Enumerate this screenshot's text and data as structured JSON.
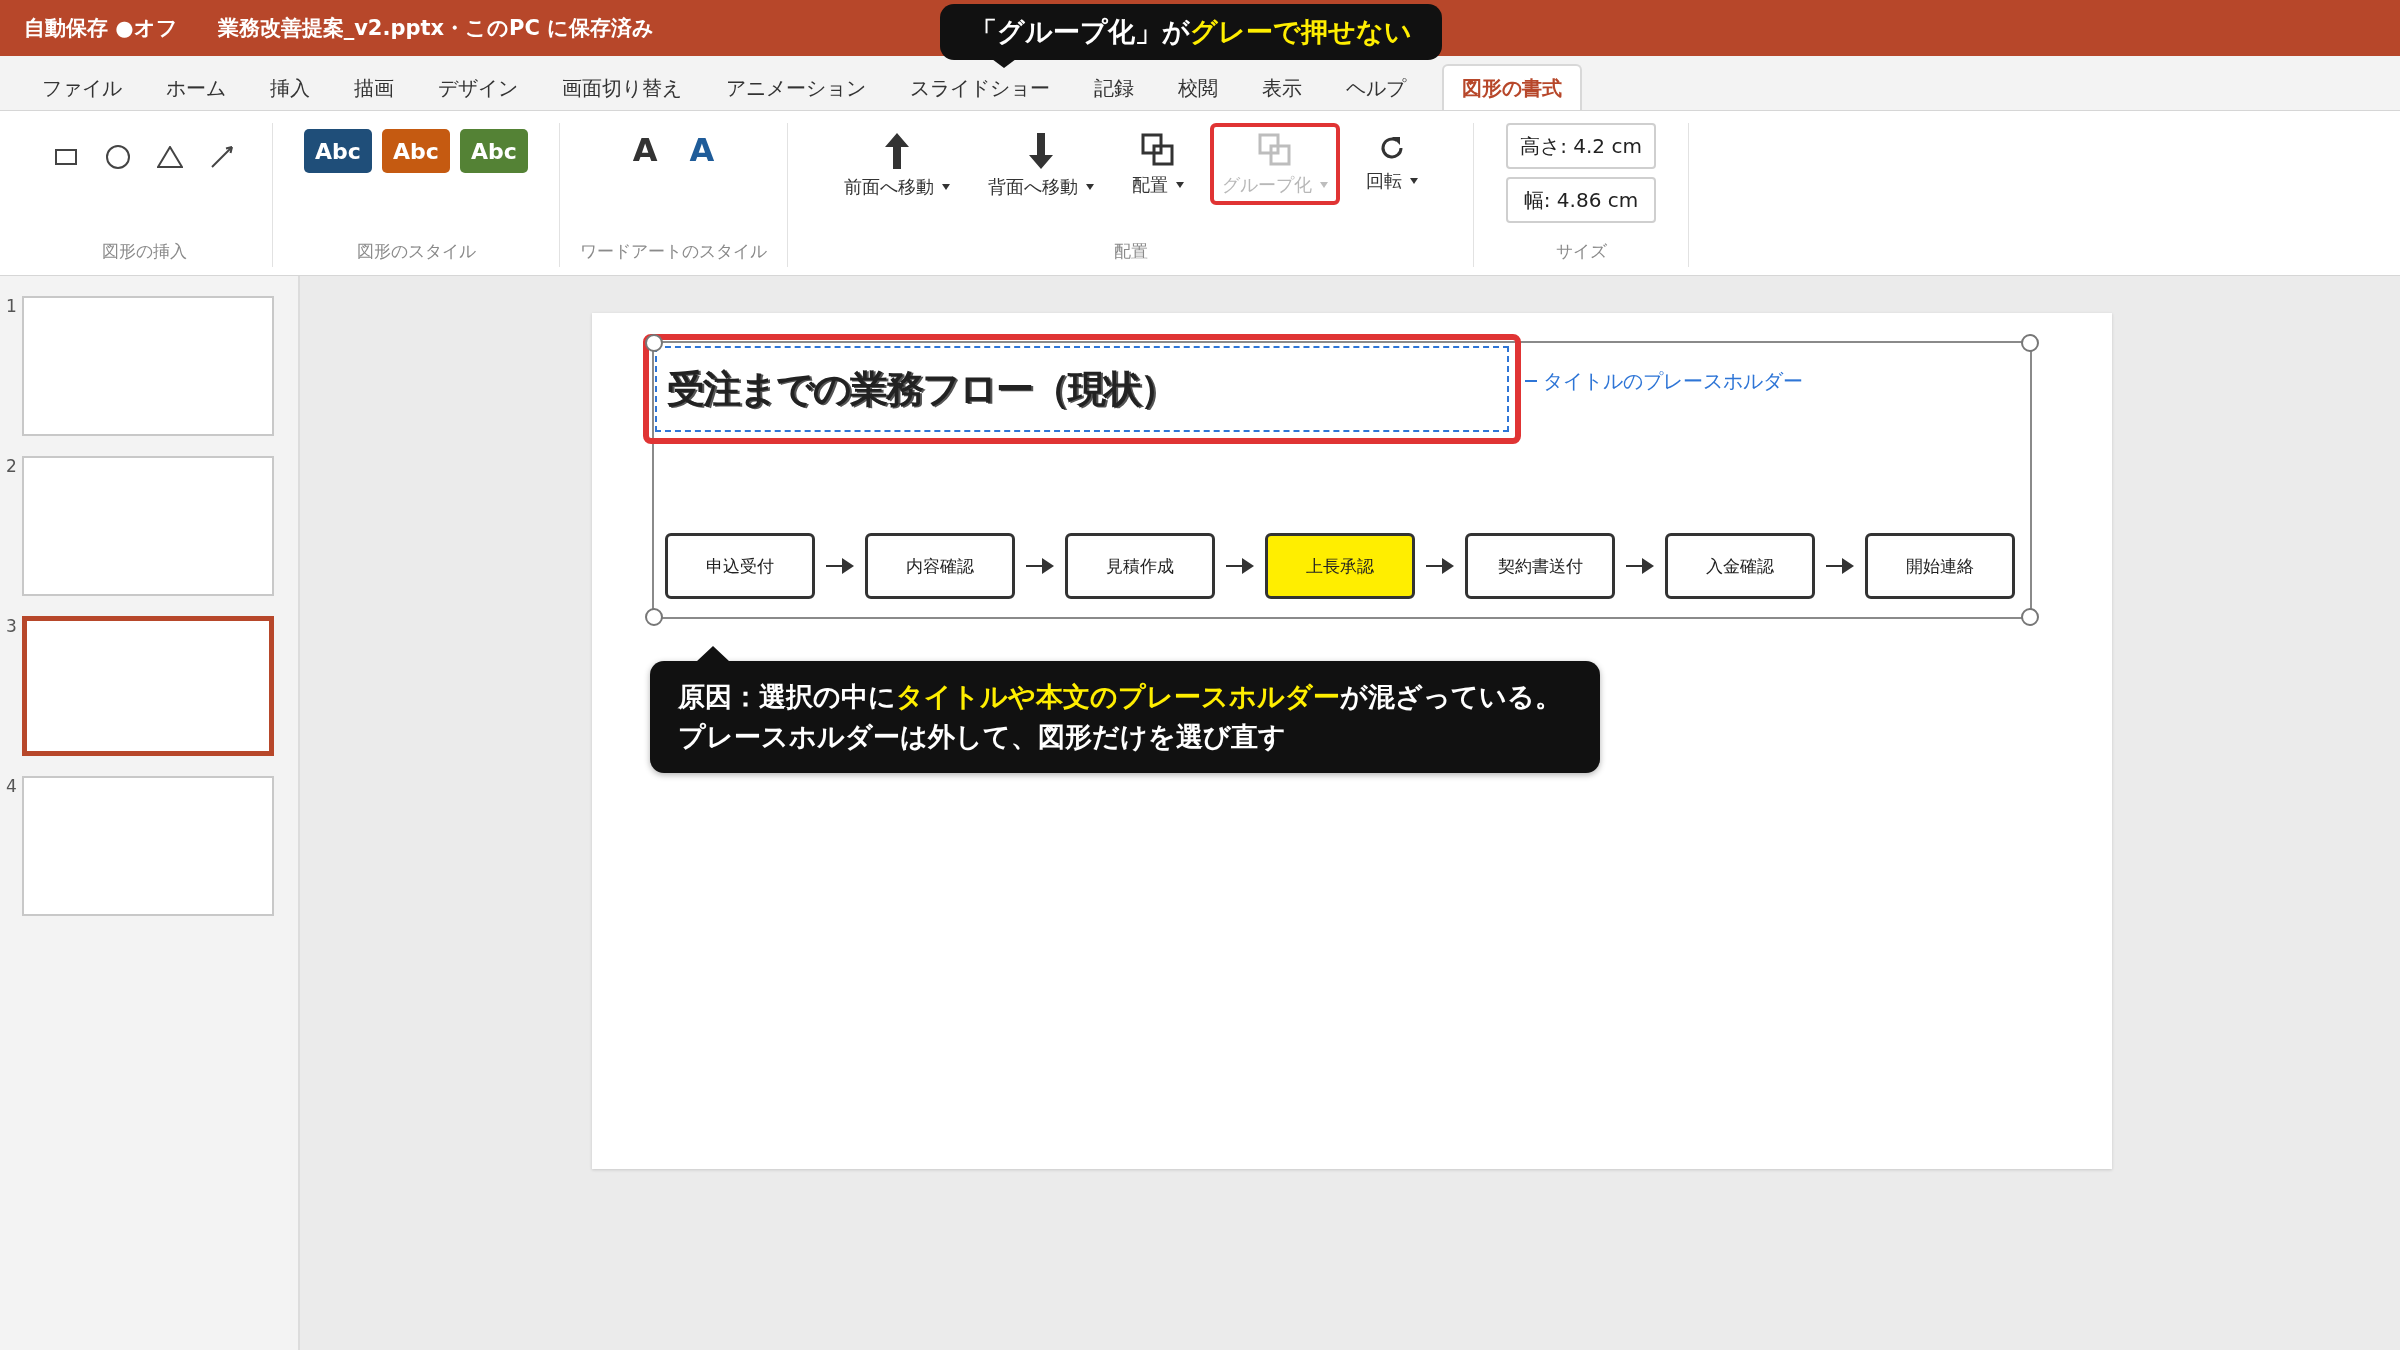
{
  "title_bar": {
    "autosave": "自動保存 ●オフ",
    "document": "業務改善提案_v2.pptx・このPC に保存済み"
  },
  "tabs": [
    {
      "label": "ファイル",
      "selected": false
    },
    {
      "label": "ホーム",
      "selected": false
    },
    {
      "label": "挿入",
      "selected": false
    },
    {
      "label": "描画",
      "selected": false
    },
    {
      "label": "デザイン",
      "selected": false
    },
    {
      "label": "画面切り替え",
      "selected": false
    },
    {
      "label": "アニメーション",
      "selected": false
    },
    {
      "label": "スライドショー",
      "selected": false
    },
    {
      "label": "記録",
      "selected": false
    },
    {
      "label": "校閲",
      "selected": false
    },
    {
      "label": "表示",
      "selected": false
    },
    {
      "label": "ヘルプ",
      "selected": false
    },
    {
      "label": "図形の書式",
      "selected": true
    }
  ],
  "ribbon": {
    "insert_shapes": {
      "label": "図形の挿入",
      "shapes": [
        {
          "kind": "rectangle"
        },
        {
          "kind": "oval"
        },
        {
          "kind": "triangle"
        },
        {
          "kind": "line"
        }
      ]
    },
    "shape_styles": {
      "label": "図形のスタイル",
      "styles": [
        {
          "label": "Abc",
          "color": "#1f4e79"
        },
        {
          "label": "Abc",
          "color": "#c55a11"
        },
        {
          "label": "Abc",
          "color": "#548235"
        }
      ]
    },
    "wordart_styles": {
      "label": "ワードアートのスタイル",
      "styles": [
        {
          "label": "A",
          "color": "#333333"
        },
        {
          "label": "A",
          "color": "#1f5c99"
        }
      ]
    },
    "arrange": {
      "label": "配置",
      "buttons": [
        {
          "label": "前面へ移動",
          "kind": "bring-forward",
          "disabled": false,
          "highlighted": false
        },
        {
          "label": "背面へ移動",
          "kind": "send-backward",
          "disabled": false,
          "highlighted": false
        },
        {
          "label": "配置",
          "kind": "align",
          "disabled": false,
          "highlighted": false
        },
        {
          "label": "グループ化",
          "kind": "group",
          "disabled": true,
          "highlighted": true
        },
        {
          "label": "回転",
          "kind": "rotate",
          "disabled": false,
          "highlighted": false
        }
      ]
    },
    "size": {
      "label": "サイズ",
      "fields": [
        {
          "value": "高さ: 4.2 cm"
        },
        {
          "value": "幅: 4.86 cm"
        }
      ]
    }
  },
  "thumbnails": [
    {
      "number": "1",
      "selected": false
    },
    {
      "number": "2",
      "selected": false
    },
    {
      "number": "3",
      "selected": true
    },
    {
      "number": "4",
      "selected": false
    }
  ],
  "slide": {
    "title": "受注までの業務フロー（現状）",
    "placeholder_label": "タイトルのプレースホルダー",
    "flow": [
      {
        "label": "申込受付",
        "highlighted": false
      },
      {
        "label": "内容確認",
        "highlighted": false
      },
      {
        "label": "見積作成",
        "highlighted": false
      },
      {
        "label": "上長承認",
        "highlighted": true
      },
      {
        "label": "契約書送付",
        "highlighted": false
      },
      {
        "label": "入金確認",
        "highlighted": false
      },
      {
        "label": "開始連絡",
        "highlighted": false
      }
    ]
  },
  "callout": [
    "原因：選択の中に**タイトルや本文のプレースホルダー**が混ざっている。",
    "プレースホルダーは外して、図形だけを選び直す"
  ],
  "tooltip": "「グループ化」が**グレーで押せない**"
}
